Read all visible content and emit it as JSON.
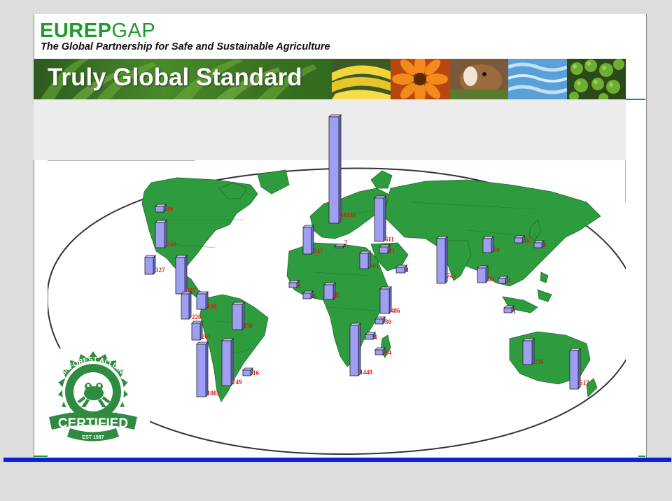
{
  "header": {
    "brand_bold": "EUREP",
    "brand_regular": "GAP",
    "tagline": "The Global Partnership for Safe and Sustainable Agriculture",
    "banner_title": "Truly Global Standard",
    "banner_photos": [
      "banana-photo",
      "flower-photo",
      "cow-photo",
      "water-photo",
      "coffee-photo"
    ]
  },
  "map_bars": [
    {
      "id": "alaska-canada",
      "label": "49",
      "value": 49
    },
    {
      "id": "usa",
      "label": "240",
      "value": 240
    },
    {
      "id": "mexico",
      "label": "327",
      "value": 327
    },
    {
      "id": "central-america",
      "label": "807",
      "value": 807
    },
    {
      "id": "colombia",
      "label": "198",
      "value": 198
    },
    {
      "id": "ecuador",
      "label": "220",
      "value": 220
    },
    {
      "id": "peru",
      "label": "261",
      "value": 261
    },
    {
      "id": "brazil",
      "label": "350",
      "value": 350
    },
    {
      "id": "chile",
      "label": "1002",
      "value": 1002
    },
    {
      "id": "argentina",
      "label": "749",
      "value": 749
    },
    {
      "id": "uruguay",
      "label": "16",
      "value": 16
    },
    {
      "id": "europe",
      "label": "18130",
      "value": 18130
    },
    {
      "id": "spain-portugal",
      "label": "247",
      "value": 247
    },
    {
      "id": "mediterranean",
      "label": "7",
      "value": 7
    },
    {
      "id": "turkey",
      "label": "611",
      "value": 611
    },
    {
      "id": "middle-east",
      "label": "11",
      "value": 11
    },
    {
      "id": "egypt",
      "label": "361",
      "value": 361
    },
    {
      "id": "arabia",
      "label": "1",
      "value": 1
    },
    {
      "id": "west-africa-1",
      "label": "1",
      "value": 1
    },
    {
      "id": "west-africa-2",
      "label": "8",
      "value": 8
    },
    {
      "id": "ghana",
      "label": "85",
      "value": 85
    },
    {
      "id": "kenya",
      "label": "486",
      "value": 486
    },
    {
      "id": "tanzania",
      "label": "30",
      "value": 30
    },
    {
      "id": "zambia",
      "label": "4",
      "value": 4
    },
    {
      "id": "madagascar",
      "label": "14",
      "value": 14
    },
    {
      "id": "south-africa",
      "label": "1448",
      "value": 1448
    },
    {
      "id": "india",
      "label": "745",
      "value": 745
    },
    {
      "id": "china",
      "label": "90",
      "value": 90
    },
    {
      "id": "korea",
      "label": "16",
      "value": 16
    },
    {
      "id": "japan",
      "label": "2",
      "value": 2
    },
    {
      "id": "thailand",
      "label": "83",
      "value": 83
    },
    {
      "id": "vietnam",
      "label": "4",
      "value": 4
    },
    {
      "id": "indonesia",
      "label": "1",
      "value": 1
    },
    {
      "id": "australia",
      "label": "236",
      "value": 236
    },
    {
      "id": "new-zealand",
      "label": "517",
      "value": 517
    }
  ],
  "seal": {
    "top_text": "RAINFOREST ALLIANCE",
    "main_text": "CERTIFIED",
    "est_text": "EST 1987"
  }
}
